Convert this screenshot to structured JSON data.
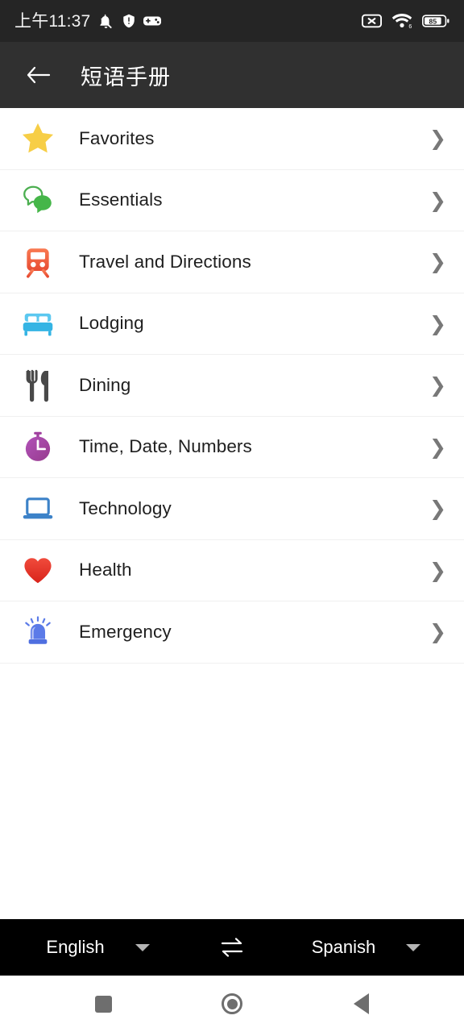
{
  "status_bar": {
    "time": "上午11:37",
    "left_icons": [
      "bell-muted-icon",
      "shield-icon",
      "gamepad-icon"
    ],
    "right_icons": [
      "no-sim-icon",
      "wifi-6-icon"
    ],
    "battery_level": "85",
    "background_color": "#252525"
  },
  "app_bar": {
    "title": "短语手册",
    "back_icon": "arrow-left-icon",
    "background_color": "#303030"
  },
  "list": {
    "chevron": "❯",
    "items": [
      {
        "label": "Favorites",
        "icon": "star-icon",
        "color": "#F7CE46"
      },
      {
        "label": "Essentials",
        "icon": "speech-bubbles-icon",
        "color": "#4CAF50"
      },
      {
        "label": "Travel and Directions",
        "icon": "train-icon",
        "color": "#F4613E"
      },
      {
        "label": "Lodging",
        "icon": "bed-icon",
        "color": "#44BCEC"
      },
      {
        "label": "Dining",
        "icon": "fork-knife-icon",
        "color": "#494949"
      },
      {
        "label": "Time, Date, Numbers",
        "icon": "stopwatch-icon",
        "color": "#A0409E"
      },
      {
        "label": "Technology",
        "icon": "laptop-icon",
        "color": "#3C82C8"
      },
      {
        "label": "Health",
        "icon": "heart-icon",
        "color": "#E8352B"
      },
      {
        "label": "Emergency",
        "icon": "siren-icon",
        "color": "#4F6FE0"
      }
    ]
  },
  "language_bar": {
    "source_language": "English",
    "target_language": "Spanish",
    "swap_icon": "swap-arrows-icon",
    "dropdown_icon": "caret-down-icon",
    "background_color": "#000000"
  },
  "nav_bar": {
    "recents_icon": "square-recents-icon",
    "home_icon": "circle-home-icon",
    "back_icon": "triangle-back-icon"
  }
}
